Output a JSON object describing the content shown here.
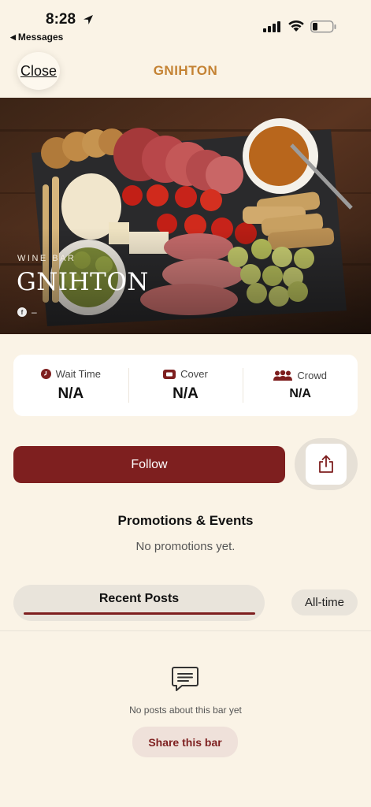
{
  "status_bar": {
    "time": "8:28",
    "back_app": "Messages"
  },
  "header": {
    "close_label": "Close",
    "title": "GNIHTON"
  },
  "hero": {
    "category": "WINE BAR",
    "name": "GNIHTON",
    "info_icon": "f",
    "info_text": "–"
  },
  "stats": {
    "wait_time": {
      "label": "Wait Time",
      "value": "N/A",
      "icon": "clock-icon"
    },
    "cover": {
      "label": "Cover",
      "value": "N/A",
      "icon": "ticket-icon"
    },
    "crowd": {
      "label": "Crowd",
      "value": "N/A",
      "icon": "people-icon"
    }
  },
  "actions": {
    "follow_label": "Follow",
    "share_icon": "share-icon"
  },
  "promotions": {
    "title": "Promotions & Events",
    "empty_text": "No promotions yet."
  },
  "tabs": {
    "recent_label": "Recent Posts",
    "alltime_label": "All-time"
  },
  "posts": {
    "empty_text": "No posts about this bar yet",
    "share_label": "Share this bar"
  },
  "colors": {
    "accent": "#7e1f1f",
    "title": "#c48233",
    "background": "#faf3e6"
  }
}
